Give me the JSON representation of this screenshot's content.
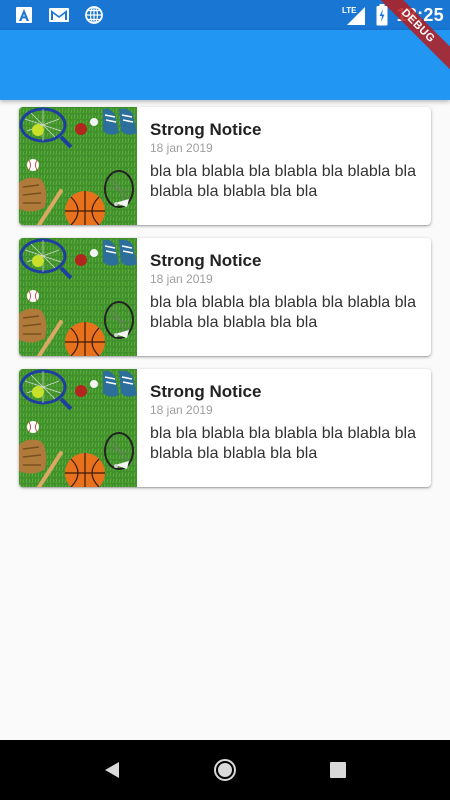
{
  "status_bar": {
    "time": "18:25",
    "network_label": "LTE",
    "icons": [
      "a-app-icon",
      "gmail-icon",
      "globe-sync-icon",
      "signal-icon",
      "battery-icon"
    ]
  },
  "debug_banner": {
    "label": "DEBUG"
  },
  "notices": [
    {
      "title": "Strong Notice",
      "date": "18 jan 2019",
      "text": "bla bla blabla bla blabla bla blabla bla blabla bla blabla bla bla"
    },
    {
      "title": "Strong Notice",
      "date": "18 jan 2019",
      "text": "bla bla blabla bla blabla bla blabla bla blabla bla blabla bla bla"
    },
    {
      "title": "Strong Notice",
      "date": "18 jan 2019",
      "text": "bla bla blabla bla blabla bla blabla bla blabla bla blabla bla bla"
    }
  ],
  "nav_bar": {
    "buttons": [
      "back-icon",
      "home-icon",
      "recents-icon"
    ]
  },
  "colors": {
    "status_bar": "#1976d2",
    "app_bar": "#2196f3",
    "background": "#fafafa",
    "nav_bar": "#000000"
  }
}
